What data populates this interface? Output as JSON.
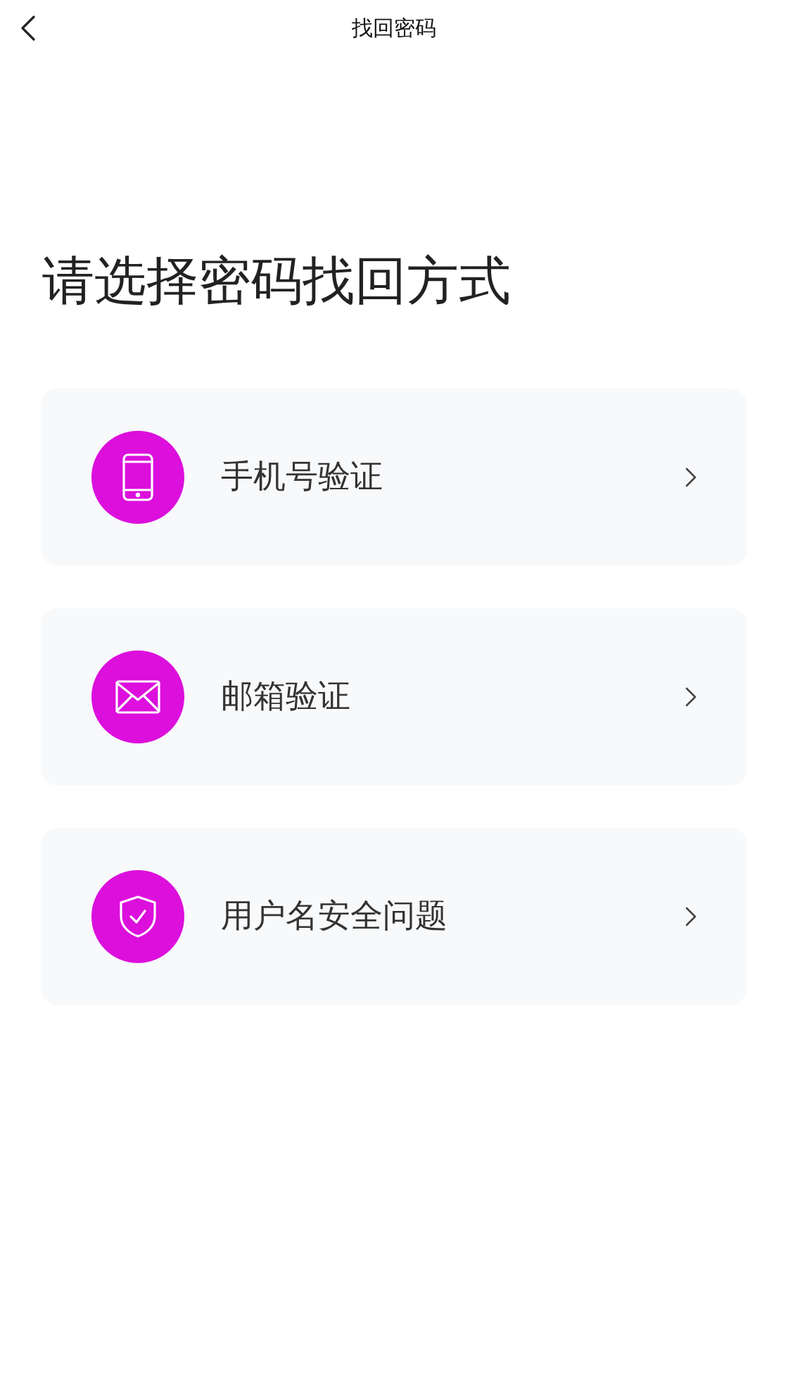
{
  "header": {
    "title": "找回密码"
  },
  "heading": "请选择密码找回方式",
  "options": [
    {
      "kind": "phone",
      "label": "手机号验证"
    },
    {
      "kind": "mail",
      "label": "邮箱验证"
    },
    {
      "kind": "shield",
      "label": "用户名安全问题"
    }
  ]
}
